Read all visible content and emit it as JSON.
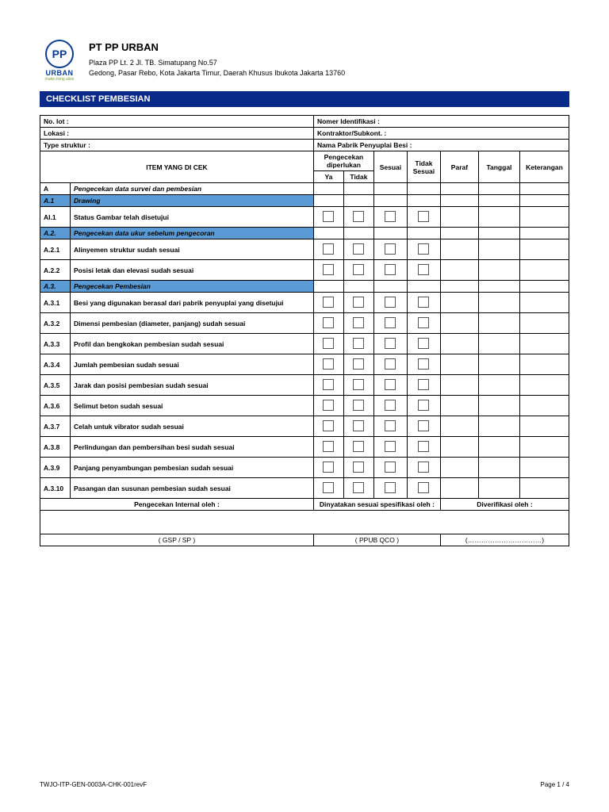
{
  "company": {
    "logo_initials": "PP",
    "logo_name": "URBAN",
    "tagline": "make living alive",
    "name": "PT PP URBAN",
    "addr1": "Plaza PP Lt. 2 Jl. TB. Simatupang No.57",
    "addr2": "Gedong, Pasar Rebo, Kota Jakarta Timur, Daerah Khusus Ibukota Jakarta 13760"
  },
  "title": "CHECKLIST PEMBESIAN",
  "info": {
    "no_lot": "No. lot :",
    "nomer_id": "Nomer Identifikasi :",
    "lokasi": "Lokasi :",
    "kontraktor": "Kontraktor/Subkont. :",
    "type_struktur": "Type struktur :",
    "nama_pabrik": "Nama Pabrik Penyuplai Besi :"
  },
  "headers": {
    "item": "ITEM YANG DI CEK",
    "pengecekan": "Pengecekan diperlukan",
    "ya": "Ya",
    "tidak": "Tidak",
    "sesuai": "Sesuai",
    "tidak_sesuai": "Tidak Sesuai",
    "paraf": "Paraf",
    "tanggal": "Tanggal",
    "keterangan": "Keterangan"
  },
  "sections": {
    "A": {
      "code": "A",
      "label": "Pengecekan data survei dan pembesian"
    },
    "A1": {
      "code": "A.1",
      "label": "Drawing"
    },
    "A2": {
      "code": "A.2.",
      "label": "Pengecekan data ukur sebelum pengecoran"
    },
    "A3": {
      "code": "A.3.",
      "label": "Pengecekan Pembesian"
    }
  },
  "rows": [
    {
      "code": "AI.1",
      "desc": "Status Gambar telah disetujui"
    },
    {
      "code": "A.2.1",
      "desc": "Alinyemen struktur sudah sesuai"
    },
    {
      "code": "A.2.2",
      "desc": "Posisi letak dan elevasi sudah sesuai"
    },
    {
      "code": "A.3.1",
      "desc": "Besi yang digunakan berasal dari pabrik penyuplai yang disetujui"
    },
    {
      "code": "A.3.2",
      "desc": "Dimensi pembesian (diameter, panjang) sudah sesuai"
    },
    {
      "code": "A.3.3",
      "desc": "Profil dan bengkokan pembesian sudah sesuai"
    },
    {
      "code": "A.3.4",
      "desc": "Jumlah pembesian sudah sesuai"
    },
    {
      "code": "A.3.5",
      "desc": "Jarak dan posisi pembesian sudah sesuai"
    },
    {
      "code": "A.3.6",
      "desc": "Selimut beton  sudah sesuai"
    },
    {
      "code": "A.3.7",
      "desc": "Celah untuk vibrator sudah sesuai"
    },
    {
      "code": "A.3.8",
      "desc": "Perlindungan dan pembersihan besi sudah sesuai"
    },
    {
      "code": "A.3.9",
      "desc": "Panjang penyambungan pembesian  sudah sesuai"
    },
    {
      "code": "A.3.10",
      "desc": "Pasangan dan susunan pembesian sudah sesuai"
    }
  ],
  "signoff": {
    "col1_label": "Pengecekan Internal oleh :",
    "col2_label": "Dinyatakan sesuai spesifikasi oleh :",
    "col3_label": "Diverifikasi oleh :",
    "col1_role": "(   GSP / SP   )",
    "col2_role": "(     PPUB QCO     )",
    "col3_role": "(……………………………)"
  },
  "footer": {
    "doc_code": "TWJO-ITP-GEN-0003A-CHK-001revF",
    "page": "Page 1 / 4"
  }
}
